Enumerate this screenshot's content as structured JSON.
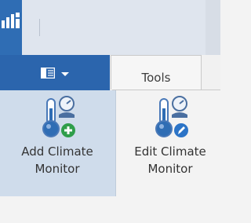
{
  "ribbon": {
    "tabs": [
      {
        "label": "",
        "icon": "layout-dropdown-icon",
        "active": true
      },
      {
        "label": "Tools",
        "active": false
      }
    ],
    "buttons": [
      {
        "label": "Add Climate\nMonitor",
        "icon": "add-climate-monitor-icon"
      },
      {
        "label": "Edit Climate\nMonitor",
        "icon": "edit-climate-monitor-icon"
      }
    ]
  },
  "colors": {
    "accent": "#2b65ad",
    "selected_button_bg": "#cfdceb",
    "add_badge": "#2f9e4a",
    "edit_badge": "#2c74c7"
  }
}
